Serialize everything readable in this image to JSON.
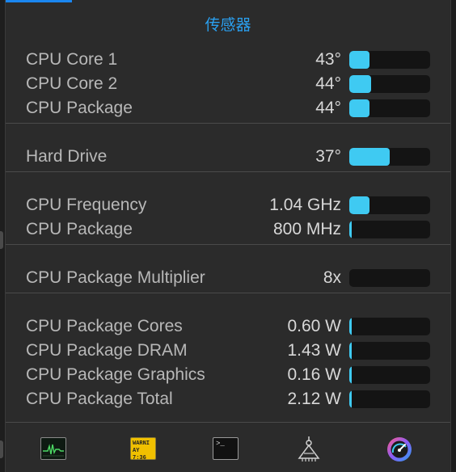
{
  "window": {
    "title": "传感器"
  },
  "colors": {
    "accent": "#2aa0f0",
    "bar_fill": "#3fcaf2",
    "bar_track": "#141414",
    "background": "#2b2b2b"
  },
  "groups": [
    {
      "rows": [
        {
          "label": "CPU Core 1",
          "value": "43°",
          "level": 0.25
        },
        {
          "label": "CPU Core 2",
          "value": "44°",
          "level": 0.27
        },
        {
          "label": "CPU Package",
          "value": "44°",
          "level": 0.25
        }
      ]
    },
    {
      "rows": [
        {
          "label": "Hard Drive",
          "value": "37°",
          "level": 0.5
        }
      ]
    },
    {
      "rows": [
        {
          "label": "CPU Frequency",
          "value": "1.04 GHz",
          "level": 0.25
        },
        {
          "label": "CPU Package",
          "value": "800 MHz",
          "level": 0.02
        }
      ]
    },
    {
      "rows": [
        {
          "label": "CPU Package Multiplier",
          "value": "8x",
          "level": 0
        }
      ]
    },
    {
      "rows": [
        {
          "label": "CPU Package Cores",
          "value": "0.60 W",
          "level": 0.02
        },
        {
          "label": "CPU Package DRAM",
          "value": "1.43 W",
          "level": 0.02
        },
        {
          "label": "CPU Package Graphics",
          "value": "0.16 W",
          "level": 0.02
        },
        {
          "label": "CPU Package Total",
          "value": "2.12 W",
          "level": 0.02
        }
      ]
    }
  ],
  "toolbar": {
    "items": [
      {
        "name": "activity-monitor-icon"
      },
      {
        "name": "console-icon",
        "text_line1": "WARNI",
        "text_line2": "AY 7:36"
      },
      {
        "name": "terminal-icon",
        "text": ">_"
      },
      {
        "name": "system-information-icon"
      },
      {
        "name": "istat-menus-icon"
      }
    ]
  }
}
